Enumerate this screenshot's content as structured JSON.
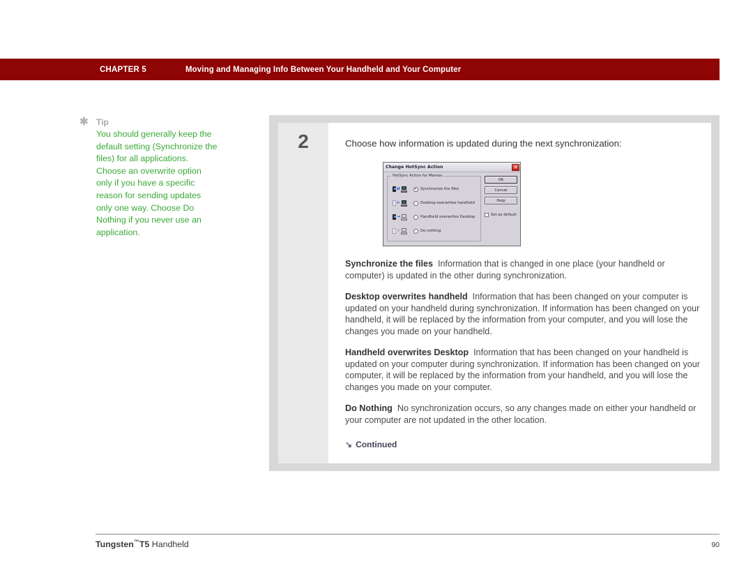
{
  "header": {
    "chapter": "CHAPTER 5",
    "title": "Moving and Managing Info Between Your Handheld and Your Computer",
    "bar_color": "#8f0405"
  },
  "tip": {
    "icon": "asterisk-icon",
    "label": "Tip",
    "text": "You should generally keep the default setting (Synchronize the files) for all applications. Choose an overwrite option only if you have a specific reason for sending updates only one way. Choose Do Nothing if you never use an application.",
    "text_color": "#3aa935"
  },
  "step": {
    "number": "2",
    "intro": "Choose how information is updated during the next synchronization:"
  },
  "dialog": {
    "title": "Change HotSync Action",
    "close_icon": "close-icon",
    "group_label": "HotSync Action for Memos",
    "options": [
      {
        "label": "Synchronize the files",
        "selected": true,
        "icon": "handheld-sync-computer-icon"
      },
      {
        "label": "Desktop overwrites handheld",
        "selected": false,
        "icon": "computer-to-handheld-icon"
      },
      {
        "label": "Handheld overwrites Desktop",
        "selected": false,
        "icon": "handheld-to-computer-icon"
      },
      {
        "label": "Do nothing",
        "selected": false,
        "icon": "no-sync-icon"
      }
    ],
    "buttons": [
      "OK",
      "Cancel",
      "Help"
    ],
    "checkbox": {
      "label": "Set as default",
      "checked": false
    }
  },
  "definitions": [
    {
      "term": "Synchronize the files",
      "description": "Information that is changed in one place (your handheld or computer) is updated in the other during synchronization."
    },
    {
      "term": "Desktop overwrites handheld",
      "description": "Information that has been changed on your computer is updated on your handheld during synchronization. If information has been changed on your handheld, it will be replaced by the information from your computer, and you will lose the changes you made on your handheld."
    },
    {
      "term": "Handheld overwrites Desktop",
      "description": "Information that has been changed on your handheld is updated on your computer during synchronization. If information has been changed on your computer, it will be replaced by the information from your handheld, and you will lose the changes you made on your computer."
    },
    {
      "term": "Do Nothing",
      "description": "No synchronization occurs, so any changes made on either your handheld or your computer are not updated in the other location."
    }
  ],
  "continued": {
    "arrow_icon": "arrow-down-right-icon",
    "label": "Continued"
  },
  "footer": {
    "product": "Tungsten",
    "trademark": "™",
    "model": "T5",
    "kind": "Handheld",
    "page": "90"
  }
}
